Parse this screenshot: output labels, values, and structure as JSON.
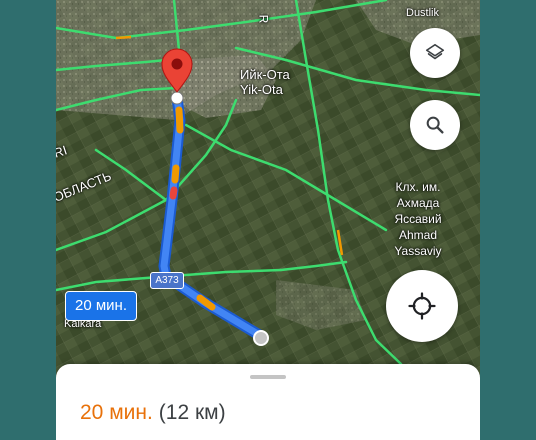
{
  "map": {
    "labels": {
      "top_letter": "R",
      "dustlik": "Dustlik",
      "yik_ota_cyrillic": "Ийк-Ота",
      "yik_ota_latin": "Yik-Ota",
      "ri_fragment": "RI",
      "oblast_fragment": "ОБЛАСТЬ",
      "kalkara": "Kalkara",
      "village_lines": [
        "Клх. им.",
        "Ахмада",
        "Яссавий",
        "Ahmad",
        "Yassaviy"
      ]
    },
    "road_shield": "A373",
    "eta_bubble": "20 мин.",
    "route_color": "#4285f4",
    "traffic_slow_color": "#f29900",
    "highway_color": "#3ddc6f"
  },
  "controls": {
    "layers_icon": "layers-icon",
    "search_icon": "search-icon",
    "locate_icon": "crosshair-icon"
  },
  "sheet": {
    "time": "20 мин.",
    "distance": "(12 км)",
    "time_color": "#e8710a"
  }
}
